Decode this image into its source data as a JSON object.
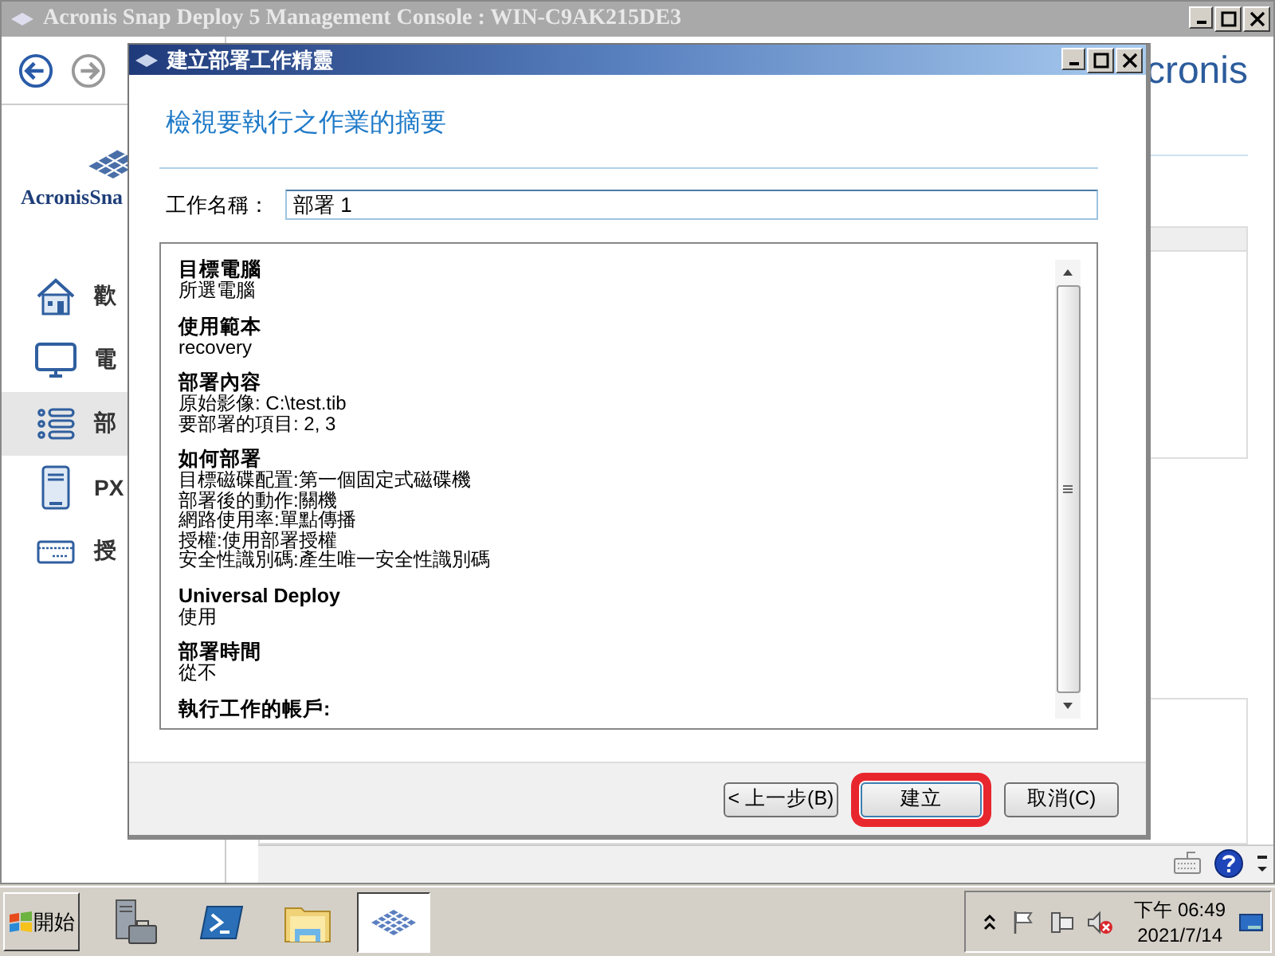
{
  "console": {
    "title": "Acronis Snap Deploy 5 Management Console : WIN-C9AK215DE3",
    "logo_text": "AcronisSna",
    "brand_text": "cronis",
    "sidebar": [
      {
        "kind": "home",
        "label": "歡",
        "selected": false
      },
      {
        "kind": "monitor",
        "label": "電",
        "selected": false
      },
      {
        "kind": "list",
        "label": "部",
        "selected": true
      },
      {
        "kind": "pxe",
        "label": "PX",
        "selected": false
      },
      {
        "kind": "card",
        "label": "授",
        "selected": false
      }
    ]
  },
  "dialog": {
    "title": "建立部署工作精靈",
    "heading": "檢視要執行之作業的摘要",
    "job_name": {
      "label": "工作名稱：",
      "value": "部署 1"
    },
    "summary": [
      {
        "title": "目標電腦",
        "lines": [
          "所選電腦"
        ]
      },
      {
        "title": "使用範本",
        "lines": [
          "recovery"
        ]
      },
      {
        "title": "部署內容",
        "lines": [
          "原始影像: C:\\test.tib",
          "要部署的項目: 2, 3"
        ]
      },
      {
        "title": "如何部署",
        "lines": [
          "目標磁碟配置:第一個固定式磁碟機",
          "部署後的動作:關機",
          "網路使用率:單點傳播",
          "授權:使用部署授權",
          "安全性識別碼:產生唯一安全性識別碼"
        ]
      },
      {
        "title": "Universal Deploy",
        "lines": [
          "使用"
        ]
      },
      {
        "title": "部署時間",
        "lines": [
          "從不"
        ]
      },
      {
        "title": "執行工作的帳戶:"
      }
    ],
    "buttons": [
      {
        "label": "< 上一步(B)",
        "highlighted": false
      },
      {
        "label": "建立",
        "highlighted": true
      },
      {
        "label": "取消(C)",
        "highlighted": false
      }
    ]
  },
  "taskbar": {
    "start": "開始",
    "apps": [
      {
        "kind": "server",
        "active": false
      },
      {
        "kind": "shell",
        "active": false
      },
      {
        "kind": "folder",
        "active": false
      },
      {
        "kind": "acronis",
        "active": true
      }
    ],
    "clock": {
      "time": "下午 06:49",
      "date": "2021/7/14"
    }
  }
}
